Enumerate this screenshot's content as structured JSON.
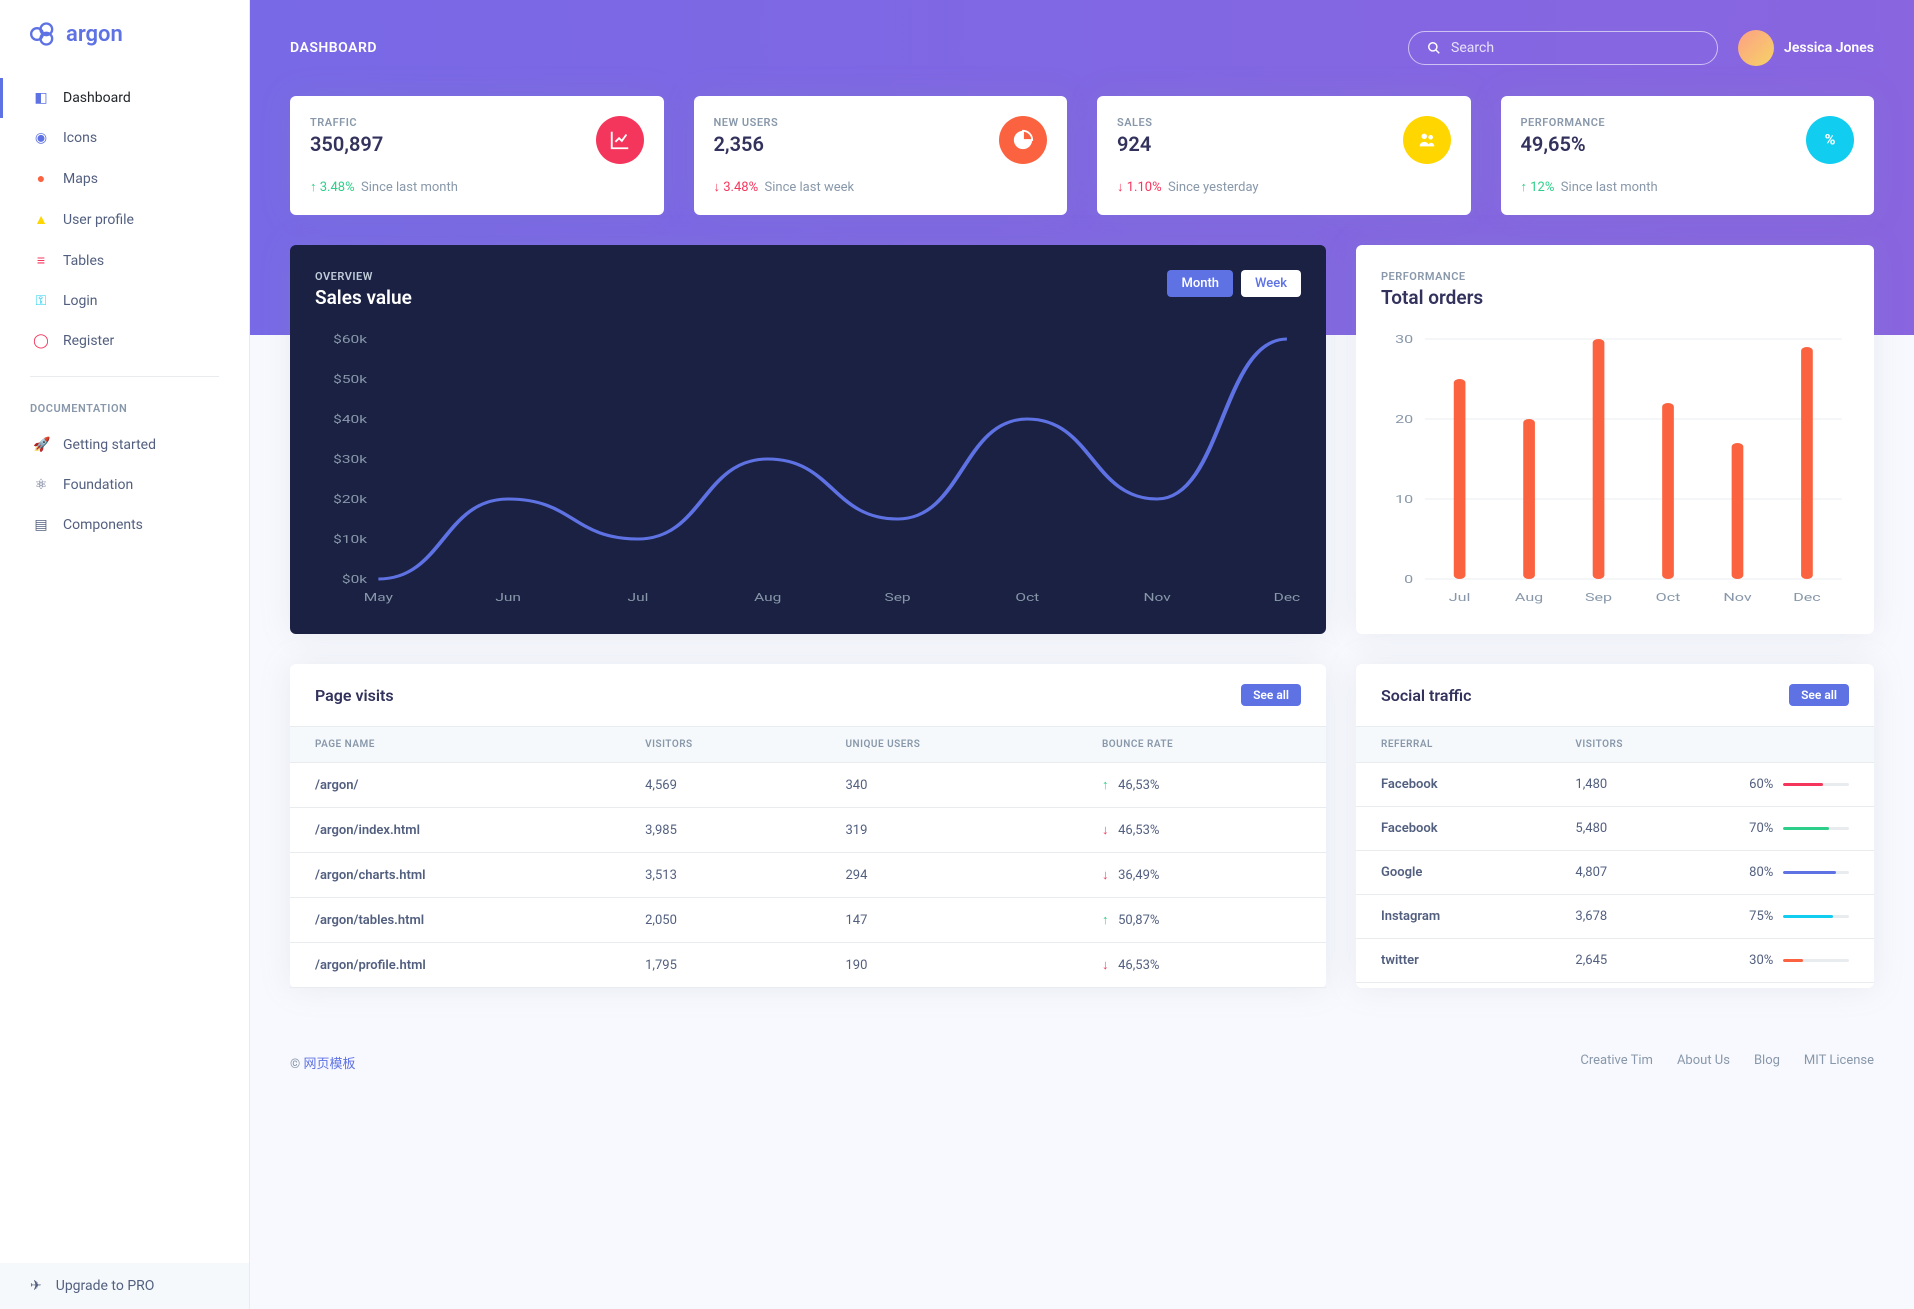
{
  "brand": "argon",
  "sidebar": {
    "items": [
      {
        "label": "Dashboard",
        "icon": "◧",
        "color": "#5e72e4"
      },
      {
        "label": "Icons",
        "icon": "◉",
        "color": "#5e72e4"
      },
      {
        "label": "Maps",
        "icon": "●",
        "color": "#fb6340"
      },
      {
        "label": "User profile",
        "icon": "▲",
        "color": "#ffd600"
      },
      {
        "label": "Tables",
        "icon": "≡",
        "color": "#f5365c"
      },
      {
        "label": "Login",
        "icon": "⚿",
        "color": "#11cdef"
      },
      {
        "label": "Register",
        "icon": "◯",
        "color": "#f5365c"
      }
    ],
    "doc_heading": "DOCUMENTATION",
    "doc_items": [
      {
        "label": "Getting started",
        "icon": "🚀"
      },
      {
        "label": "Foundation",
        "icon": "⚛"
      },
      {
        "label": "Components",
        "icon": "▤"
      }
    ],
    "upgrade": "Upgrade to PRO"
  },
  "header": {
    "title": "DASHBOARD",
    "search_placeholder": "Search",
    "user_name": "Jessica Jones"
  },
  "stat_cards": [
    {
      "label": "TRAFFIC",
      "value": "350,897",
      "delta": "3.48%",
      "dir": "up",
      "since": "Since last month",
      "icon_color": "#f5365c",
      "icon": "chart"
    },
    {
      "label": "NEW USERS",
      "value": "2,356",
      "delta": "3.48%",
      "dir": "down",
      "since": "Since last week",
      "icon_color": "#fb6340",
      "icon": "pie"
    },
    {
      "label": "SALES",
      "value": "924",
      "delta": "1.10%",
      "dir": "down",
      "since": "Since yesterday",
      "icon_color": "#ffd600",
      "icon": "users"
    },
    {
      "label": "PERFORMANCE",
      "value": "49,65%",
      "delta": "12%",
      "dir": "up",
      "since": "Since last month",
      "icon_color": "#11cdef",
      "icon": "percent"
    }
  ],
  "sales_chart": {
    "overline": "OVERVIEW",
    "title": "Sales value",
    "month_label": "Month",
    "week_label": "Week"
  },
  "orders_chart": {
    "overline": "PERFORMANCE",
    "title": "Total orders"
  },
  "page_visits": {
    "title": "Page visits",
    "see_all": "See all",
    "columns": [
      "PAGE NAME",
      "VISITORS",
      "UNIQUE USERS",
      "BOUNCE RATE"
    ],
    "rows": [
      {
        "page": "/argon/",
        "visitors": "4,569",
        "unique": "340",
        "dir": "up",
        "rate": "46,53%"
      },
      {
        "page": "/argon/index.html",
        "visitors": "3,985",
        "unique": "319",
        "dir": "down",
        "rate": "46,53%"
      },
      {
        "page": "/argon/charts.html",
        "visitors": "3,513",
        "unique": "294",
        "dir": "down",
        "rate": "36,49%"
      },
      {
        "page": "/argon/tables.html",
        "visitors": "2,050",
        "unique": "147",
        "dir": "up",
        "rate": "50,87%"
      },
      {
        "page": "/argon/profile.html",
        "visitors": "1,795",
        "unique": "190",
        "dir": "down",
        "rate": "46,53%"
      }
    ]
  },
  "social": {
    "title": "Social traffic",
    "see_all": "See all",
    "columns": [
      "REFERRAL",
      "VISITORS",
      ""
    ],
    "rows": [
      {
        "ref": "Facebook",
        "visitors": "1,480",
        "pct": "60%",
        "v": 60,
        "color": "#f5365c"
      },
      {
        "ref": "Facebook",
        "visitors": "5,480",
        "pct": "70%",
        "v": 70,
        "color": "#2dce89"
      },
      {
        "ref": "Google",
        "visitors": "4,807",
        "pct": "80%",
        "v": 80,
        "color": "#5e72e4"
      },
      {
        "ref": "Instagram",
        "visitors": "3,678",
        "pct": "75%",
        "v": 75,
        "color": "#11cdef"
      },
      {
        "ref": "twitter",
        "visitors": "2,645",
        "pct": "30%",
        "v": 30,
        "color": "#fb6340"
      }
    ]
  },
  "footer": {
    "copyright": "©",
    "brand": "网页模板",
    "links": [
      "Creative Tim",
      "About Us",
      "Blog",
      "MIT License"
    ]
  },
  "chart_data": [
    {
      "type": "line",
      "title": "Sales value",
      "xlabel": "",
      "ylabel": "",
      "categories": [
        "May",
        "Jun",
        "Jul",
        "Aug",
        "Sep",
        "Oct",
        "Nov",
        "Dec"
      ],
      "values": [
        0,
        20,
        10,
        30,
        15,
        40,
        20,
        60
      ],
      "ylim": [
        0,
        60
      ],
      "yticks": [
        "$0k",
        "$10k",
        "$20k",
        "$30k",
        "$40k",
        "$50k",
        "$60k"
      ]
    },
    {
      "type": "bar",
      "title": "Total orders",
      "xlabel": "",
      "ylabel": "",
      "categories": [
        "Jul",
        "Aug",
        "Sep",
        "Oct",
        "Nov",
        "Dec"
      ],
      "values": [
        25,
        20,
        30,
        22,
        17,
        29
      ],
      "ylim": [
        0,
        30
      ],
      "yticks": [
        0,
        10,
        20,
        30
      ]
    }
  ]
}
